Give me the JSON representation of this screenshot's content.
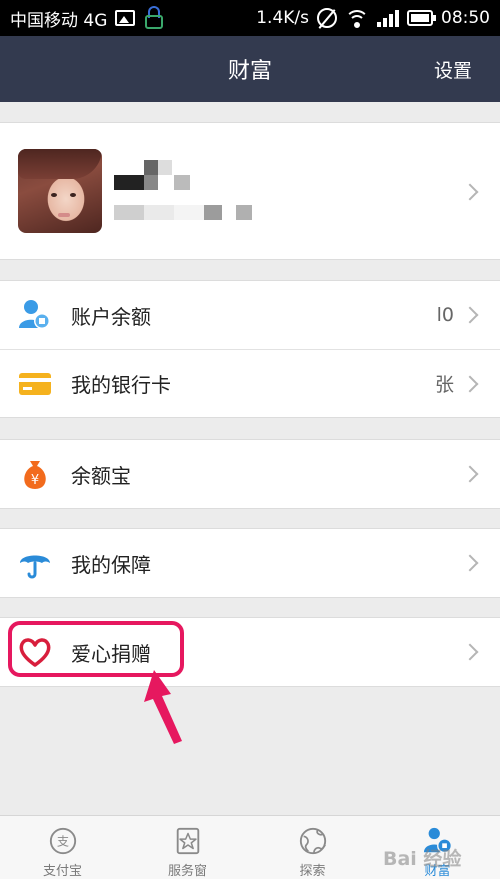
{
  "status_bar": {
    "carrier": "中国移动 4G",
    "speed": "1.4K/s",
    "time": "08:50"
  },
  "header": {
    "title": "财富",
    "settings_label": "设置"
  },
  "menu": {
    "account_balance": {
      "label": "账户余额",
      "value": "l0"
    },
    "bank_card": {
      "label": "我的银行卡",
      "value": "张"
    },
    "yuebao": {
      "label": "余额宝",
      "icon_text": "¥"
    },
    "protection": {
      "label": "我的保障"
    },
    "charity": {
      "label": "爱心捐赠"
    }
  },
  "tabs": [
    {
      "label": "支付宝",
      "icon": "alipay-icon"
    },
    {
      "label": "服务窗",
      "icon": "star-window-icon"
    },
    {
      "label": "探索",
      "icon": "globe-icon"
    },
    {
      "label": "财富",
      "icon": "wealth-icon",
      "active": true
    }
  ],
  "watermark": "Bai 经验",
  "colors": {
    "header_bg": "#333a4f",
    "highlight": "#e6185f",
    "accent_blue": "#2a8bd8",
    "bank_yellow": "#f5b21e",
    "yuebao_orange": "#f26b1d"
  }
}
